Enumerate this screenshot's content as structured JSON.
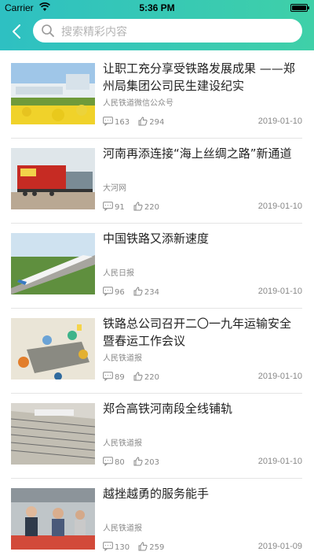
{
  "status_bar": {
    "carrier": "Carrier",
    "time": "5:36 PM"
  },
  "header": {
    "back_icon": "chevron-left-icon",
    "search_placeholder": "搜索精彩内容",
    "search_icon": "search-icon"
  },
  "colors": {
    "header_from": "#2ec0c2",
    "header_to": "#3fd0a8"
  },
  "articles": [
    {
      "title": "让职工充分享受铁路发展成果 ——郑州局集团公司民生建设纪实",
      "source": "人民铁道微信公众号",
      "comments": "163",
      "likes": "294",
      "date": "2019-01-10"
    },
    {
      "title": "河南再添连接“海上丝绸之路”新通道",
      "source": "大河网",
      "comments": "91",
      "likes": "220",
      "date": "2019-01-10"
    },
    {
      "title": "中国铁路又添新速度",
      "source": "人民日报",
      "comments": "96",
      "likes": "234",
      "date": "2019-01-10"
    },
    {
      "title": "铁路总公司召开二〇一九年运输安全暨春运工作会议",
      "source": "人民铁道报",
      "comments": "89",
      "likes": "220",
      "date": "2019-01-10"
    },
    {
      "title": "郑合高铁河南段全线铺轨",
      "source": "人民铁道报",
      "comments": "80",
      "likes": "203",
      "date": "2019-01-10"
    },
    {
      "title": "越挫越勇的服务能手",
      "source": "人民铁道报",
      "comments": "130",
      "likes": "259",
      "date": "2019-01-09"
    }
  ]
}
